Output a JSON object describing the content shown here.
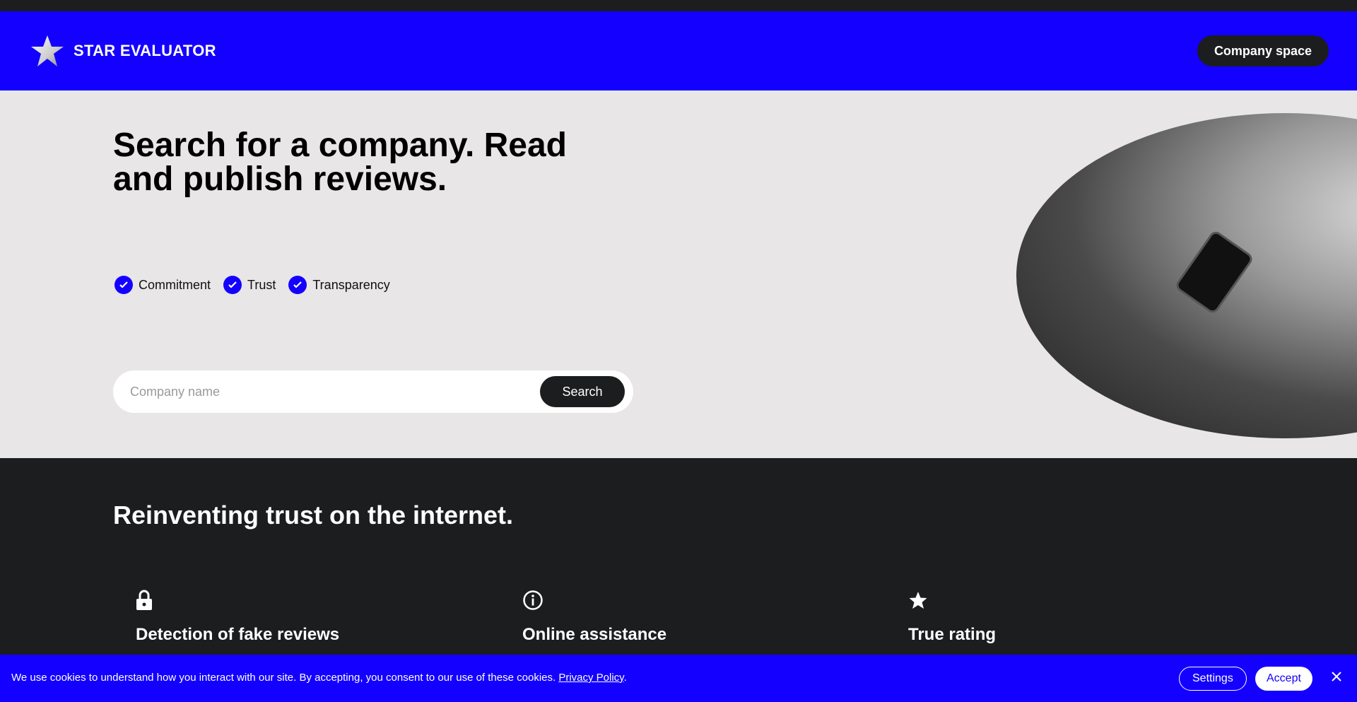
{
  "header": {
    "brand": "STAR EVALUATOR",
    "company_space": "Company space",
    "accent": "#1400ff"
  },
  "hero": {
    "title": "Search for a company. Read and publish reviews.",
    "values": [
      "Commitment",
      "Trust",
      "Transparency"
    ],
    "search_placeholder": "Company name",
    "search_button": "Search"
  },
  "section": {
    "title": "Reinventing trust on the internet.",
    "features": [
      {
        "icon": "lock-icon",
        "title": "Detection of fake reviews"
      },
      {
        "icon": "info-icon",
        "title": "Online assistance"
      },
      {
        "icon": "star-icon",
        "title": "True rating"
      }
    ]
  },
  "cookie": {
    "text": "We use cookies to understand how you interact with our site. By accepting, you consent to our use of these cookies. ",
    "policy_link": "Privacy Policy",
    "settings": "Settings",
    "accept": "Accept"
  }
}
